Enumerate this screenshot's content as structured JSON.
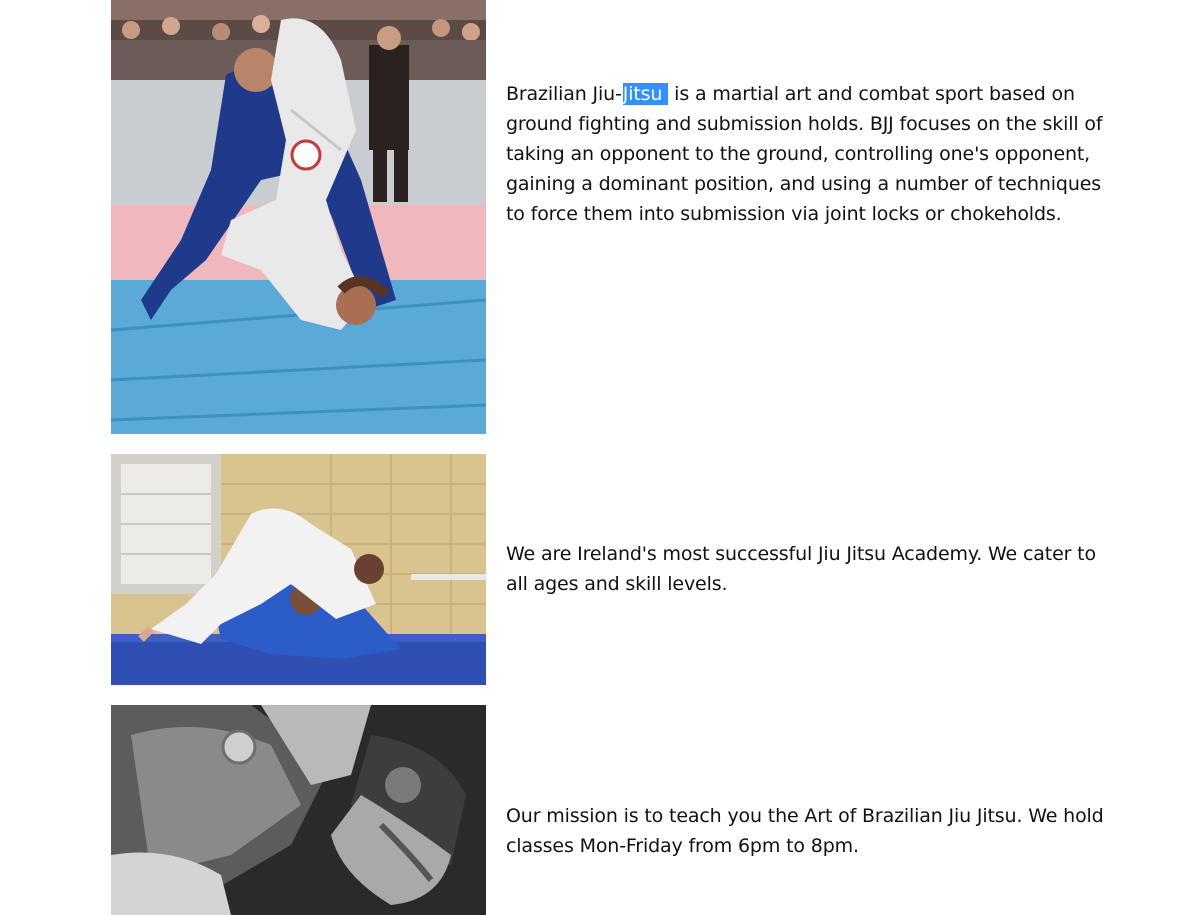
{
  "sections": [
    {
      "image_alt": "Two grapplers training on a blue mat at a competition",
      "text_before": "Brazilian Jiu-",
      "text_highlight": "Jitsu",
      "text_after": " is a martial art and combat sport based on ground fighting and submission holds. BJJ focuses on the skill of taking an opponent to the ground, controlling one's opponent, gaining a dominant position, and using a number of techniques to force them into submission via joint locks or chokeholds."
    },
    {
      "image_alt": "Two grapplers rolling on a blue mat in a gym",
      "text": "We are Ireland's most successful Jiu Jitsu Academy. We cater to all ages and skill levels."
    },
    {
      "image_alt": "Black and white close-up of a grappler in a gi",
      "text": "Our mission is to teach you the Art of Brazilian Jiu Jitsu. We hold classes Mon-Friday from 6pm to 8pm."
    }
  ],
  "colors": {
    "selection_highlight": "#3390ff",
    "mat_blue": "#4a9fd4",
    "gi_navy": "#1f3a8a"
  }
}
